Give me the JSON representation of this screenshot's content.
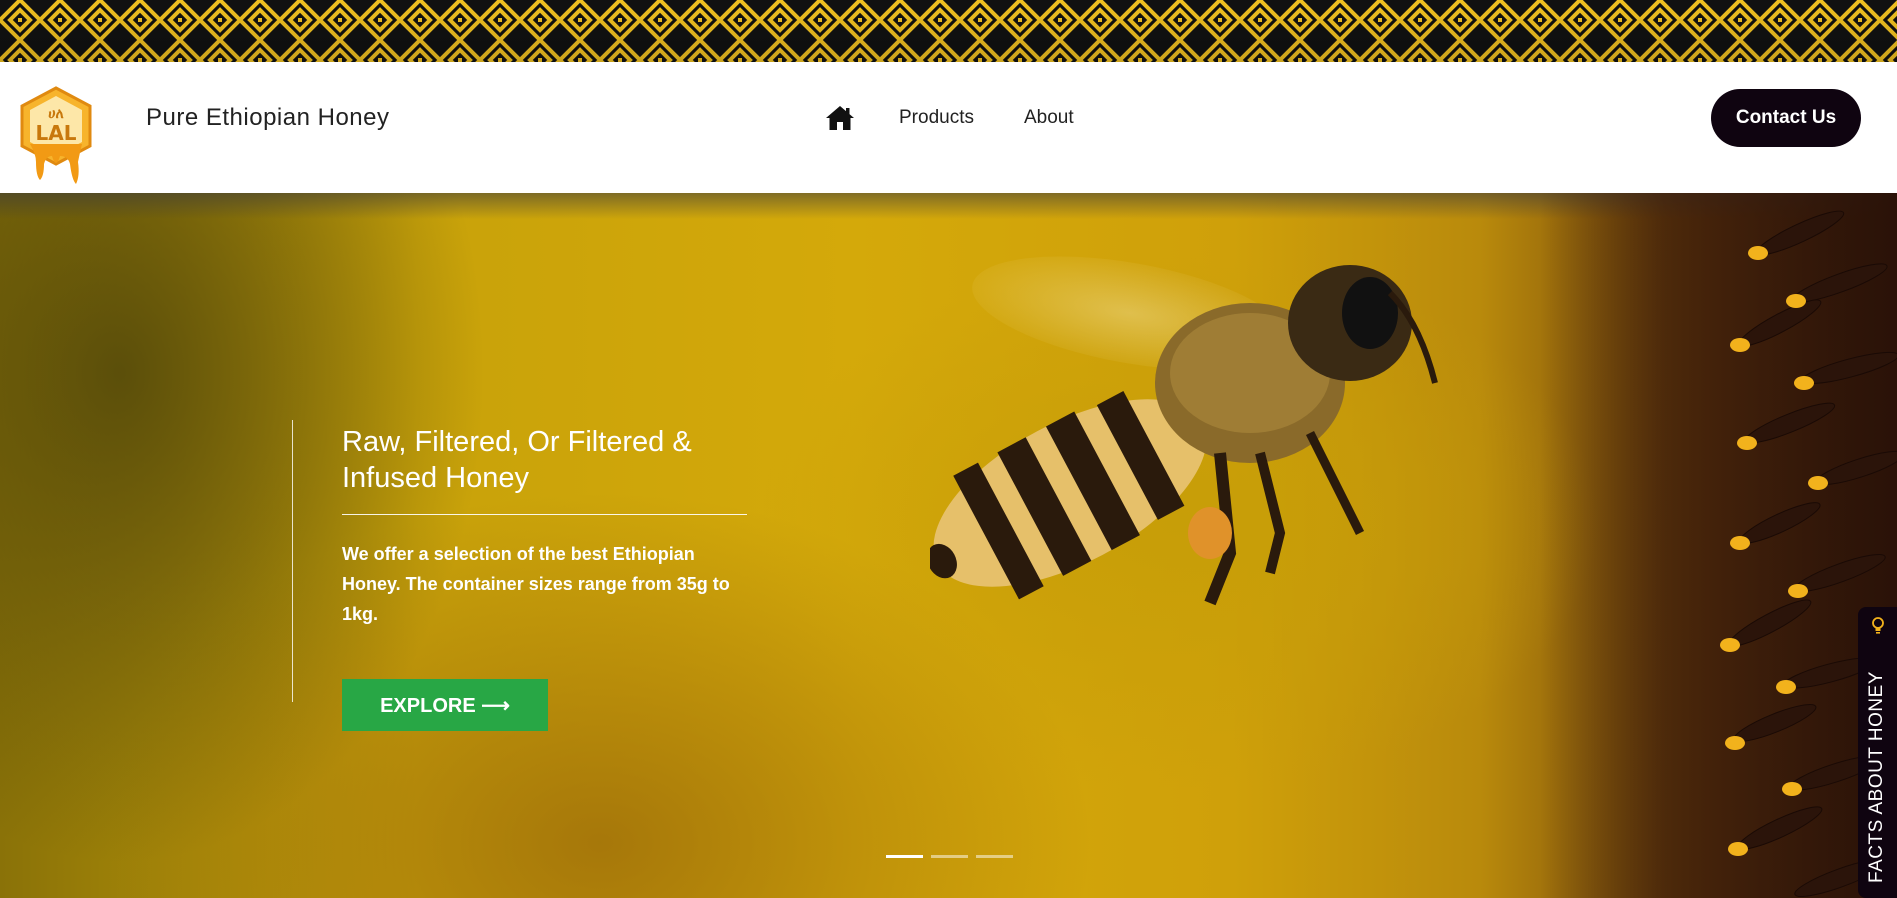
{
  "brand": {
    "logo_text_top": "ሀለ",
    "logo_text": "LAL",
    "name": "Pure Ethiopian Honey"
  },
  "nav": {
    "home_icon": "home-icon",
    "items": [
      {
        "label": "Products"
      },
      {
        "label": "About"
      }
    ]
  },
  "header": {
    "contact_label": "Contact Us"
  },
  "hero": {
    "title": "Raw, Filtered, Or Filtered & Infused Honey",
    "description": "We offer a selection of the best Ethiopian Honey. The container sizes range from 35g to 1kg.",
    "cta_label": "EXPLORE ⟶",
    "slides": 3,
    "active_slide": 1
  },
  "facts_tab": {
    "label": "FACTS ABOUT HONEY",
    "icon": "lightbulb-icon"
  },
  "colors": {
    "pattern_dark": "#111111",
    "pattern_gold": "#f0c020",
    "contact_bg": "#0f0410",
    "cta_green": "#28a745",
    "honey_yellow": "#d4a90a"
  }
}
